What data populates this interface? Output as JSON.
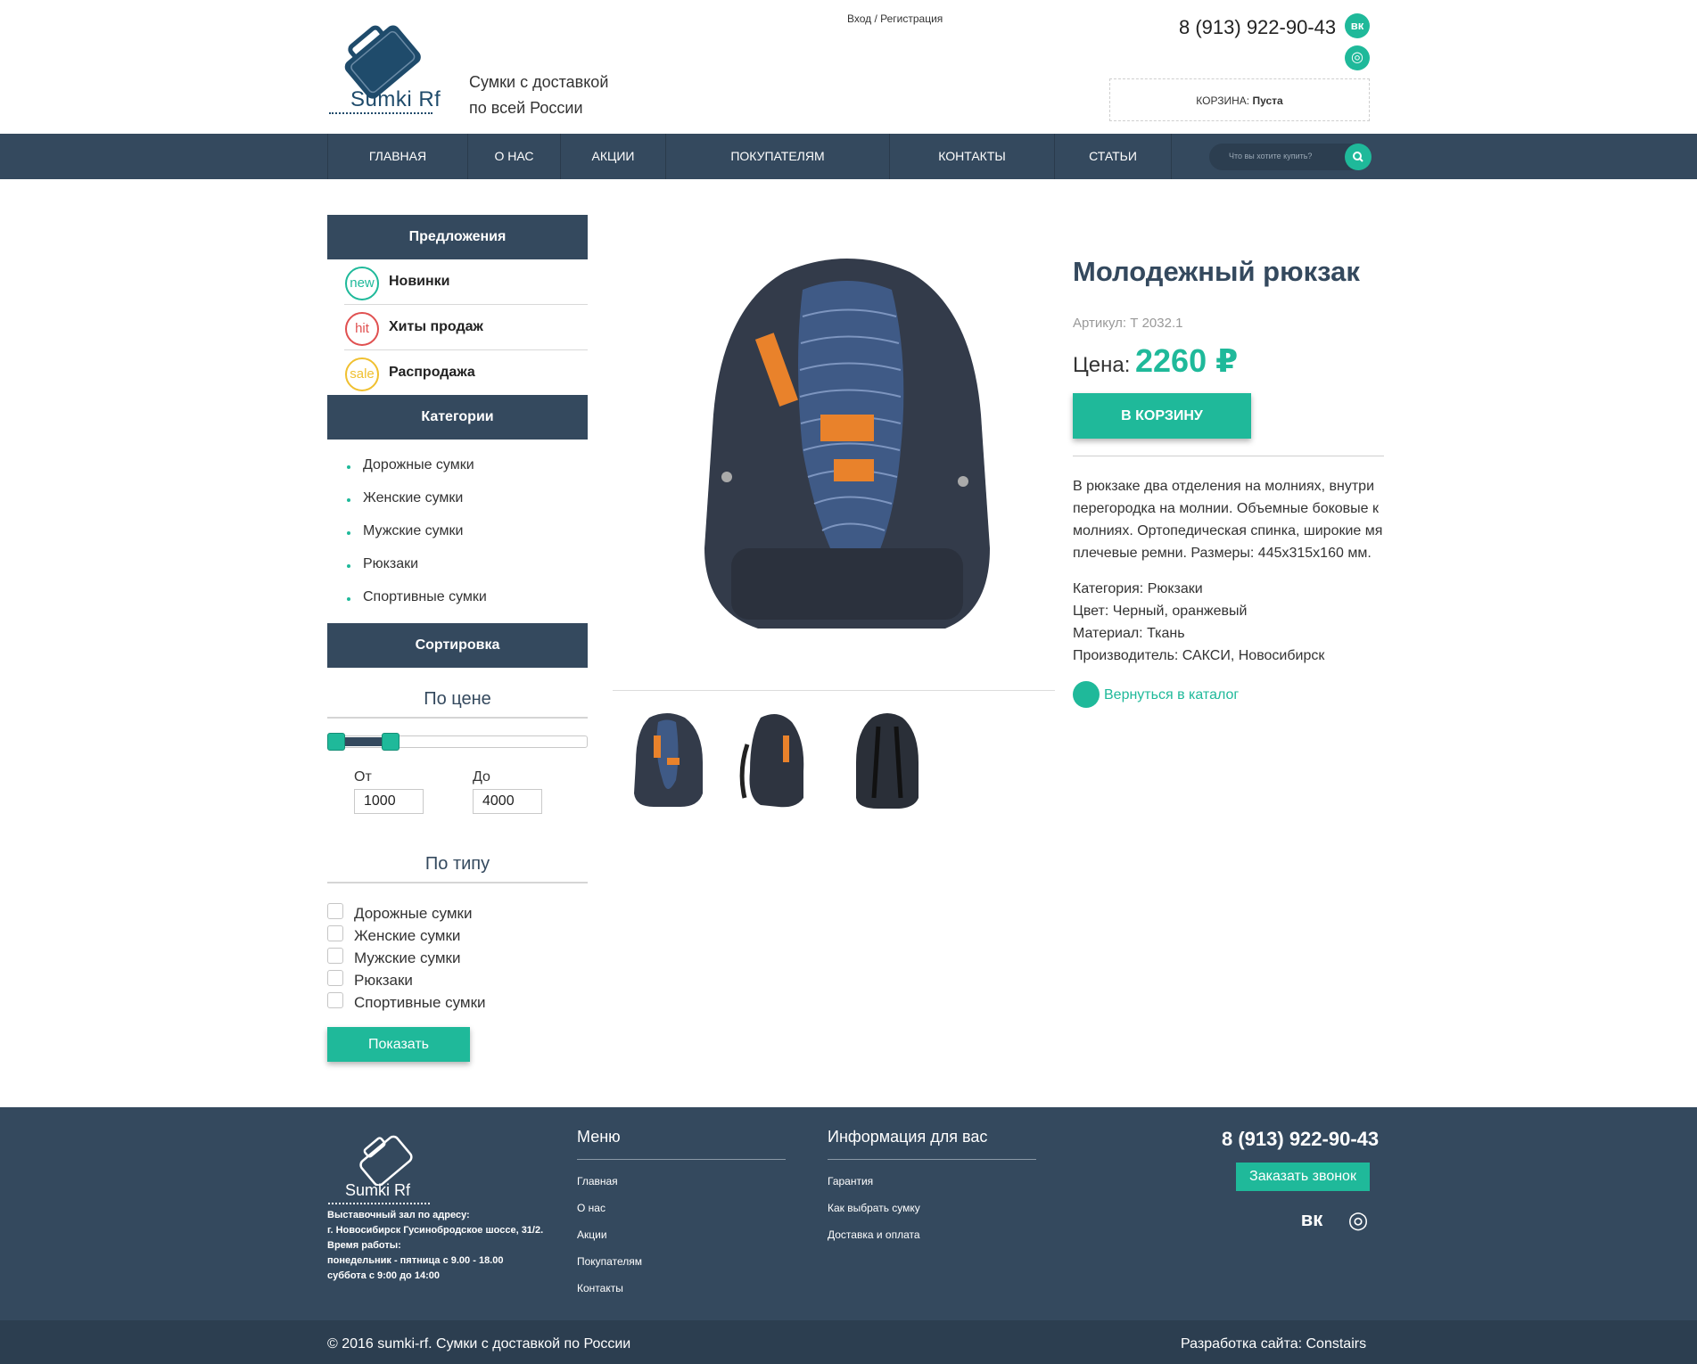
{
  "header": {
    "logo_text": "Sumki Rf",
    "tagline_1": "Сумки с доставкой",
    "tagline_2": "по всей России",
    "auth": "Вход / Регистрация",
    "phone": "8 (913) 922-90-43",
    "social": [
      {
        "name": "vk-icon",
        "glyph": "вк"
      },
      {
        "name": "instagram-icon",
        "glyph": "◎"
      }
    ],
    "cart_label": "КОРЗИНА:",
    "cart_status": "Пуста"
  },
  "nav": {
    "items": [
      "ГЛАВНАЯ",
      "О НАС",
      "АКЦИИ",
      "ПОКУПАТЕЛЯМ",
      "КОНТАКТЫ",
      "СТАТЬИ"
    ],
    "search_placeholder": "Что вы хотите купить?"
  },
  "sidebar": {
    "offers_title": "Предложения",
    "offers": [
      {
        "badge": "new",
        "label": "Новинки",
        "color": "#1fb99a"
      },
      {
        "badge": "hit",
        "label": "Хиты продаж",
        "color": "#e05050"
      },
      {
        "badge": "sale",
        "label": "Распродажа",
        "color": "#f0c030"
      }
    ],
    "categories_title": "Категории",
    "categories": [
      "Дорожные сумки",
      "Женские сумки",
      "Мужские сумки",
      "Рюкзаки",
      "Спортивные сумки"
    ],
    "sort_title": "Сортировка",
    "price_title": "По цене",
    "from_label": "От",
    "to_label": "До",
    "from_value": "1000",
    "to_value": "4000",
    "type_title": "По типу",
    "types": [
      "Дорожные сумки",
      "Женские сумки",
      "Мужские сумки",
      "Рюкзаки",
      "Спортивные сумки"
    ],
    "show_button": "Показать"
  },
  "product": {
    "title": "Молодежный рюкзак",
    "sku": "Артикул: Т 2032.1",
    "price_label": "Цена:",
    "price": "2260 ₽",
    "cart_button": "В КОРЗИНУ",
    "description_lines": [
      "В рюкзаке два отделения на молниях, внутри",
      "перегородка на молнии. Объемные боковые к",
      "молниях. Ортопедическая спинка, широкие мя",
      "плечевые ремни. Размеры: 445х315х160 мм."
    ],
    "meta": [
      "Категория: Рюкзаки",
      "Цвет: Черный, оранжевый",
      "Материал: Ткань",
      "Производитель: САКСИ, Новосибирск"
    ],
    "back_link": "Вернуться в каталог"
  },
  "footer": {
    "logo_text": "Sumki Rf",
    "address": [
      "Выставочный зал по адресу:",
      "г. Новосибирск Гусинобродское шоссе, 31/2.",
      "Время работы:",
      "понедельник - пятница с 9.00 - 18.00",
      "суббота с 9:00 до 14:00"
    ],
    "menu_title": "Меню",
    "menu": [
      "Главная",
      "О нас",
      "Акции",
      "Покупателям",
      "Контакты"
    ],
    "info_title": "Информация для вас",
    "info": [
      "Гарантия",
      "Как выбрать сумку",
      "Доставка и оплата"
    ],
    "phone": "8 (913) 922-90-43",
    "call_button": "Заказать звонок",
    "social": [
      {
        "name": "vk-icon",
        "glyph": "вк"
      },
      {
        "name": "instagram-icon",
        "glyph": "◎"
      }
    ],
    "copyright": "© 2016 sumki-rf. Сумки с доставкой по России",
    "developer": "Разработка сайта: Constairs"
  }
}
